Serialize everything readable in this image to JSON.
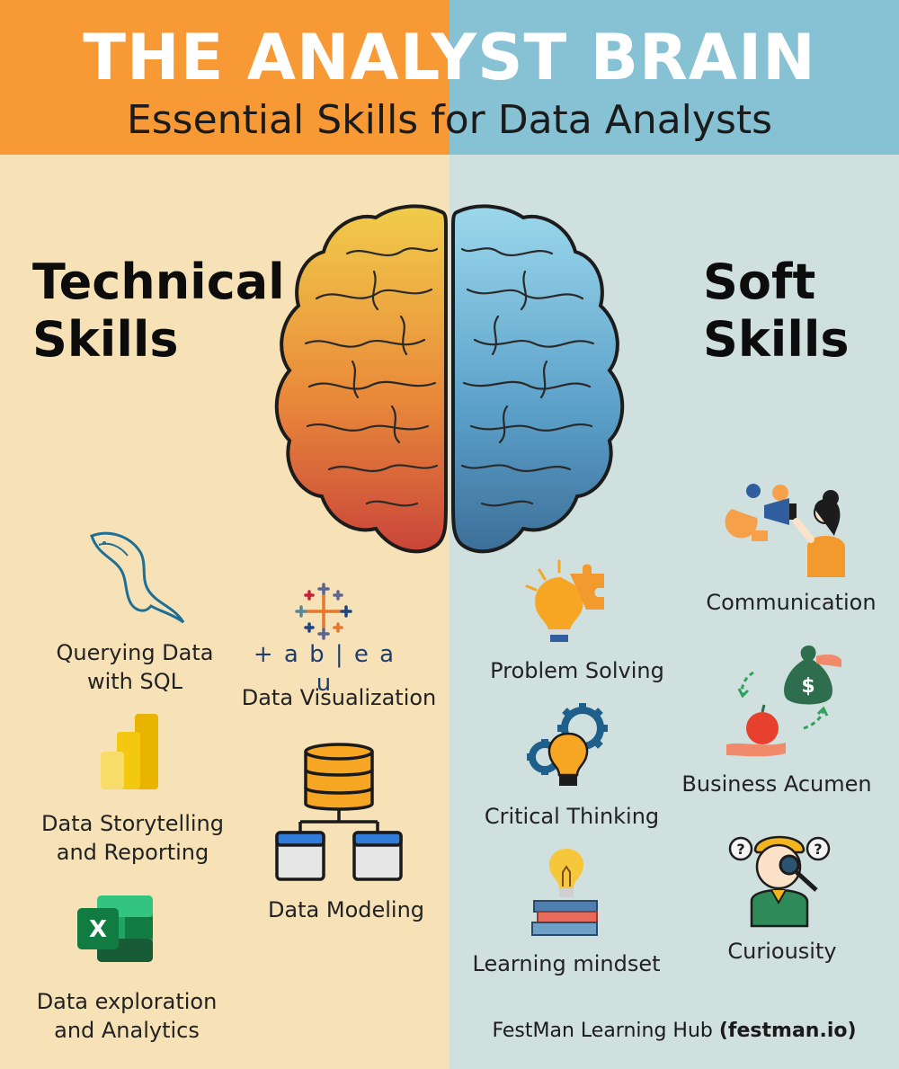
{
  "header": {
    "title": "THE ANALYST BRAIN",
    "subtitle": "Essential Skills for Data Analysts"
  },
  "colors": {
    "left_header": "#f79a36",
    "right_header": "#86c2d4",
    "left_background": "#f7e2b8",
    "right_background": "#cfe0df"
  },
  "technical": {
    "title_line1": "Technical",
    "title_line2": "Skills",
    "items": [
      {
        "line1": "Querying Data",
        "line2": "with SQL",
        "icon": "mysql-dolphin-icon"
      },
      {
        "line1": "Data Visualization",
        "icon": "tableau-logo-icon",
        "logo_text": "+ a b | e a u"
      },
      {
        "line1": "Data Storytelling",
        "line2": "and Reporting",
        "icon": "power-bi-icon"
      },
      {
        "line1": "Data Modeling",
        "icon": "database-model-icon"
      },
      {
        "line1": "Data exploration",
        "line2": "and Analytics",
        "icon": "excel-icon",
        "icon_letter": "X"
      }
    ]
  },
  "soft": {
    "title_line1": "Soft",
    "title_line2": "Skills",
    "items": [
      {
        "line1": "Communication",
        "icon": "megaphone-woman-icon"
      },
      {
        "line1": "Problem Solving",
        "icon": "lightbulb-puzzle-icon"
      },
      {
        "line1": "Business Acumen",
        "icon": "money-bag-apple-icon",
        "icon_symbol": "$"
      },
      {
        "line1": "Critical Thinking",
        "icon": "gears-lightbulb-icon"
      },
      {
        "line1": "Curiousity",
        "icon": "magnifier-person-icon",
        "icon_symbol": "?"
      },
      {
        "line1": "Learning mindset",
        "icon": "books-lightbulb-icon"
      }
    ]
  },
  "footer": {
    "text": "FestMan Learning Hub",
    "link": "(festman.io)"
  }
}
